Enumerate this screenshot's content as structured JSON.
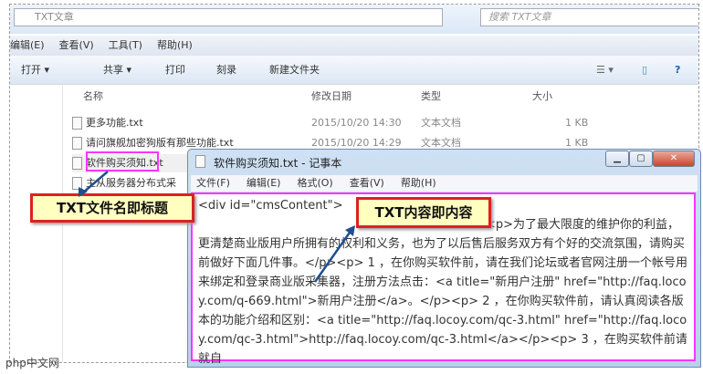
{
  "explorer": {
    "breadcrumb": "TXT文章",
    "search_placeholder": "搜索 TXT文章",
    "menu": [
      "编辑(E)",
      "查看(V)",
      "工具(T)",
      "帮助(H)"
    ],
    "toolbar": {
      "open": "打开 ▾",
      "share": "共享 ▾",
      "print": "打印",
      "burn": "刻录",
      "new_folder": "新建文件夹"
    },
    "columns": [
      "名称",
      "修改日期",
      "类型",
      "大小"
    ],
    "files": [
      {
        "name": "更多功能.txt",
        "date": "2015/10/20 14:30",
        "type": "文本文档",
        "size": "1 KB"
      },
      {
        "name": "请问旗舰加密狗版有那些功能.txt",
        "date": "2015/10/20 14:29",
        "type": "文本文档",
        "size": "1 KB"
      },
      {
        "name": "软件购买须知.txt",
        "date": "",
        "type": "",
        "size": ""
      },
      {
        "name": "主从服务器分布式采",
        "date": "",
        "type": "",
        "size": ""
      }
    ]
  },
  "notepad": {
    "title": "软件购买须知.txt - 记事本",
    "menu": [
      "文件(F)",
      "编辑(E)",
      "格式(O)",
      "查看(V)",
      "帮助(H)"
    ],
    "line1": "<div id=\"cmsContent\">",
    "body": "<p>为了最大限度的维护你的利益，更清楚商业版用户所拥有的权利和义务，也为了以后售后服务双方有个好的交流氛围，请购买前做好下面几件事。</p><p> 1 ，在你购买软件前，请在我们论坛或者官网注册一个帐号用来绑定和登录商业版采集器，注册方法点击：<a title=\"新用户注册\" href=\"http://faq.locoy.com/q-669.html\">新用户注册</a>。</p><p> 2 ，在你购买软件前，请认真阅读各版本的功能介绍和区别：<a title=\"http://faq.locoy.com/qc-3.html\" href=\"http://faq.locoy.com/qc-3.html\">http://faq.locoy.com/qc-3.html</a></p><p> 3 ，在购买软件前请就自"
  },
  "callouts": {
    "filename": "TXT文件名即标题",
    "content": "TXT内容即内容"
  },
  "watermark": "php中文网"
}
